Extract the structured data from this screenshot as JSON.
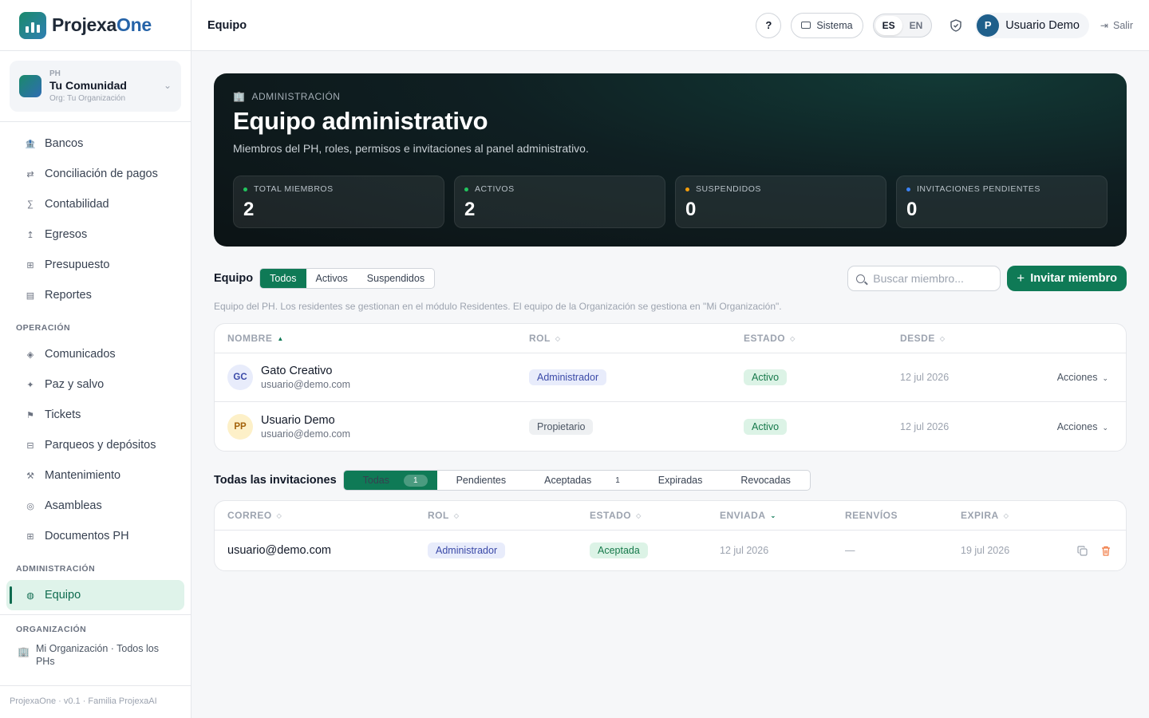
{
  "brand": {
    "name_a": "Projexa",
    "name_b": "One"
  },
  "org_selector": {
    "kind": "PH",
    "name": "Tu Comunidad",
    "sub": "Org: Tu Organización"
  },
  "nav": {
    "items": [
      {
        "id": "bancos",
        "label": "Bancos",
        "icon": "bank-icon"
      },
      {
        "id": "conciliacion",
        "label": "Conciliación de pagos",
        "icon": "swap-icon"
      },
      {
        "id": "contabilidad",
        "label": "Contabilidad",
        "icon": "sigma-icon"
      },
      {
        "id": "egresos",
        "label": "Egresos",
        "icon": "outflow-icon"
      },
      {
        "id": "presupuesto",
        "label": "Presupuesto",
        "icon": "grid-icon"
      },
      {
        "id": "reportes",
        "label": "Reportes",
        "icon": "report-icon"
      }
    ],
    "operacion_head": "OPERACIÓN",
    "operacion": [
      {
        "id": "comunicados",
        "label": "Comunicados",
        "icon": "diamond-icon"
      },
      {
        "id": "paz-y-salvo",
        "label": "Paz y salvo",
        "icon": "sparkle-icon"
      },
      {
        "id": "tickets",
        "label": "Tickets",
        "icon": "flag-icon"
      },
      {
        "id": "parqueos",
        "label": "Parqueos y depósitos",
        "icon": "parking-icon"
      },
      {
        "id": "mantenimiento",
        "label": "Mantenimiento",
        "icon": "tools-icon"
      },
      {
        "id": "asambleas",
        "label": "Asambleas",
        "icon": "circle-icon"
      },
      {
        "id": "documentos",
        "label": "Documentos PH",
        "icon": "document-icon"
      }
    ],
    "admin_head": "ADMINISTRACIÓN",
    "admin": [
      {
        "id": "equipo",
        "label": "Equipo",
        "icon": "team-icon"
      }
    ],
    "org_head": "ORGANIZACIÓN",
    "org_link": "Mi Organización · Todos los PHs"
  },
  "footer": "ProjexaOne · v0.1 · Familia ProjexaAI",
  "topbar": {
    "title": "Equipo",
    "help": "?",
    "system": "Sistema",
    "lang": [
      "ES",
      "EN"
    ],
    "lang_active": "ES",
    "user_initial": "P",
    "user_name": "Usuario Demo",
    "logout": "Salir"
  },
  "hero": {
    "kicker": "ADMINISTRACIÓN",
    "title": "Equipo administrativo",
    "subtitle": "Miembros del PH, roles, permisos e invitaciones al panel administrativo.",
    "stats": [
      {
        "label": "TOTAL MIEMBROS",
        "value": "2",
        "color": "#22c55e"
      },
      {
        "label": "ACTIVOS",
        "value": "2",
        "color": "#22c55e"
      },
      {
        "label": "SUSPENDIDOS",
        "value": "0",
        "color": "#f59e0b"
      },
      {
        "label": "INVITACIONES PENDIENTES",
        "value": "0",
        "color": "#3b82f6"
      }
    ]
  },
  "team": {
    "title": "Equipo",
    "filters": [
      "Todos",
      "Activos",
      "Suspendidos"
    ],
    "filter_active": "Todos",
    "search_placeholder": "Buscar miembro...",
    "invite_label": "Invitar miembro",
    "note": "Equipo del PH. Los residentes se gestionan en el módulo Residentes. El equipo de la Organización se gestiona en \"Mi Organización\".",
    "columns": [
      "NOMBRE",
      "ROL",
      "ESTADO",
      "DESDE"
    ],
    "rows": [
      {
        "initials": "GC",
        "name": "Gato Creativo",
        "email": "usuario@demo.com",
        "role": "Administrador",
        "status": "Activo",
        "since": "12 jul 2026",
        "actions": "Acciones"
      },
      {
        "initials": "PP",
        "name": "Usuario Demo",
        "email": "usuario@demo.com",
        "role": "Propietario",
        "status": "Activo",
        "since": "12 jul 2026",
        "actions": "Acciones"
      }
    ]
  },
  "invitations": {
    "title": "Todas las invitaciones",
    "filters": [
      {
        "label": "Todas",
        "count": "1"
      },
      {
        "label": "Pendientes",
        "count": ""
      },
      {
        "label": "Aceptadas",
        "count": "1"
      },
      {
        "label": "Expiradas",
        "count": ""
      },
      {
        "label": "Revocadas",
        "count": ""
      }
    ],
    "filter_active": "Todas",
    "columns": [
      "CORREO",
      "ROL",
      "ESTADO",
      "ENVIADA",
      "REENVÍOS",
      "EXPIRA"
    ],
    "rows": [
      {
        "email": "usuario@demo.com",
        "role": "Administrador",
        "status": "Aceptada",
        "sent": "12 jul 2026",
        "resends": "—",
        "expires": "19 jul 2026"
      }
    ]
  }
}
